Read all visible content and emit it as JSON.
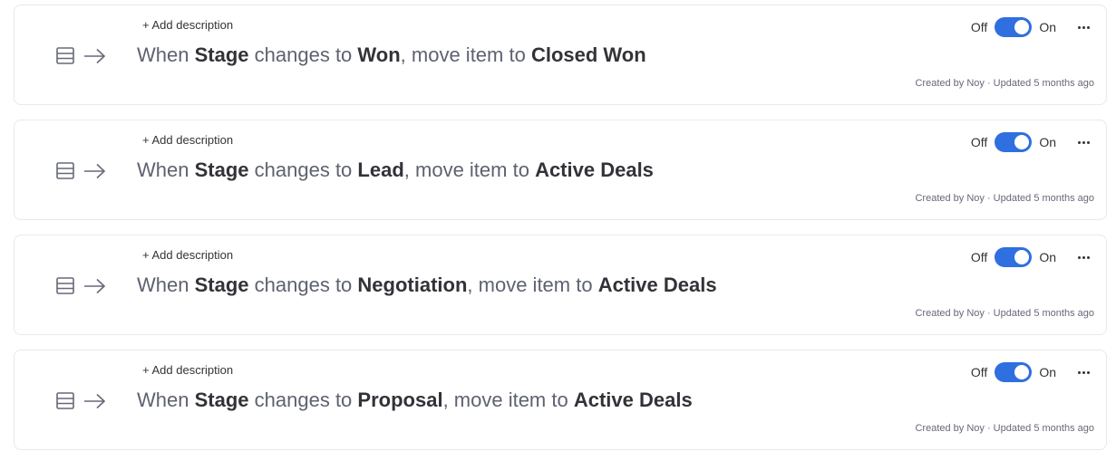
{
  "colors": {
    "accent": "#2f6fe0",
    "text_primary": "#323338",
    "text_secondary": "#5e6270",
    "border": "#e6e9ef"
  },
  "recipes": [
    {
      "add_description": "+ Add description",
      "parts": {
        "when": "When",
        "column": "Stage",
        "changes_to": "changes to",
        "value": "Won",
        "move": ", move item to",
        "group": "Closed Won"
      },
      "toggle": {
        "off": "Off",
        "on": "On",
        "state": "on"
      },
      "meta": "Created by Noy · Updated 5 months ago"
    },
    {
      "add_description": "+ Add description",
      "parts": {
        "when": "When",
        "column": "Stage",
        "changes_to": "changes to",
        "value": "Lead",
        "move": ", move item to",
        "group": "Active Deals"
      },
      "toggle": {
        "off": "Off",
        "on": "On",
        "state": "on"
      },
      "meta": "Created by Noy · Updated 5 months ago"
    },
    {
      "add_description": "+ Add description",
      "parts": {
        "when": "When",
        "column": "Stage",
        "changes_to": "changes to",
        "value": "Negotiation",
        "move": ", move item to",
        "group": "Active Deals"
      },
      "toggle": {
        "off": "Off",
        "on": "On",
        "state": "on"
      },
      "meta": "Created by Noy · Updated 5 months ago"
    },
    {
      "add_description": "+ Add description",
      "parts": {
        "when": "When",
        "column": "Stage",
        "changes_to": "changes to",
        "value": "Proposal",
        "move": ", move item to",
        "group": "Active Deals"
      },
      "toggle": {
        "off": "Off",
        "on": "On",
        "state": "on"
      },
      "meta": "Created by Noy · Updated 5 months ago"
    }
  ]
}
